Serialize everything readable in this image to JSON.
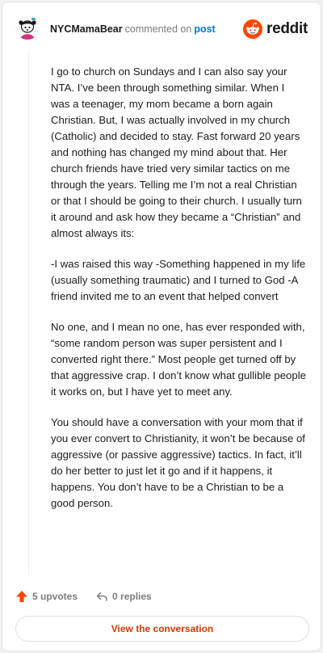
{
  "header": {
    "username": "NYCMamaBear",
    "action_text": "commented on",
    "post_link": "post",
    "brand": "reddit"
  },
  "comment": {
    "paragraphs": [
      "I go to church on Sundays and I can also say your NTA. I’ve been through something similar. When I was a teenager, my mom became a born again Christian. But, I was actually involved in my church (Catholic) and decided to stay. Fast forward 20 years and nothing has changed my mind about that. Her church friends have tried very similar tactics on me through the years. Telling me I’m not a real Christian or that I should be going to their church. I usually turn it around and ask how they became a “Christian” and almost always its:",
      "-I was raised this way -Something happened in my life (usually something traumatic) and I turned to God -A friend invited me to an event that helped convert",
      "No one, and I mean no one, has ever responded with, “some random person was super persistent and I converted right there.” Most people get turned off by that aggressive crap. I don’t know what gullible people it works on, but I have yet to meet any.",
      "You should have a conversation with your mom that if you ever convert to Christianity, it won’t be because of aggressive (or passive aggressive) tactics. In fact, it’ll do her better to just let it go and if it happens, it happens. You don’t have to be a Christian to be a good person."
    ]
  },
  "actions": {
    "upvotes": "5 upvotes",
    "replies": "0 replies"
  },
  "cta": {
    "label": "View the conversation"
  },
  "colors": {
    "reddit_orange": "#ff4500",
    "upvote": "#ff4500",
    "link_blue": "#0079d3",
    "cta_text": "#d93900"
  },
  "icons": {
    "avatar": "avatar",
    "brand_logo": "reddit-logo-icon",
    "upvote": "upvote-arrow-icon",
    "reply": "reply-arrow-icon"
  }
}
